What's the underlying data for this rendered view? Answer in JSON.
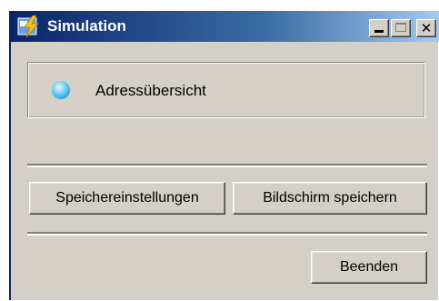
{
  "window": {
    "title": "Simulation",
    "app_icon": "simulation-app-icon",
    "controls": {
      "minimize_icon": "minimize-icon",
      "maximize_icon": "maximize-icon",
      "close_glyph": "✕",
      "close_icon": "close-icon"
    },
    "titlebar_color": "#0a246a"
  },
  "status": {
    "indicator_icon": "status-light-icon",
    "indicator_color": "#1ea6e0",
    "label": "Adressübersicht"
  },
  "buttons": {
    "storage_settings": "Speichereinstellungen",
    "save_screen": "Bildschirm speichern",
    "exit": "Beenden"
  }
}
